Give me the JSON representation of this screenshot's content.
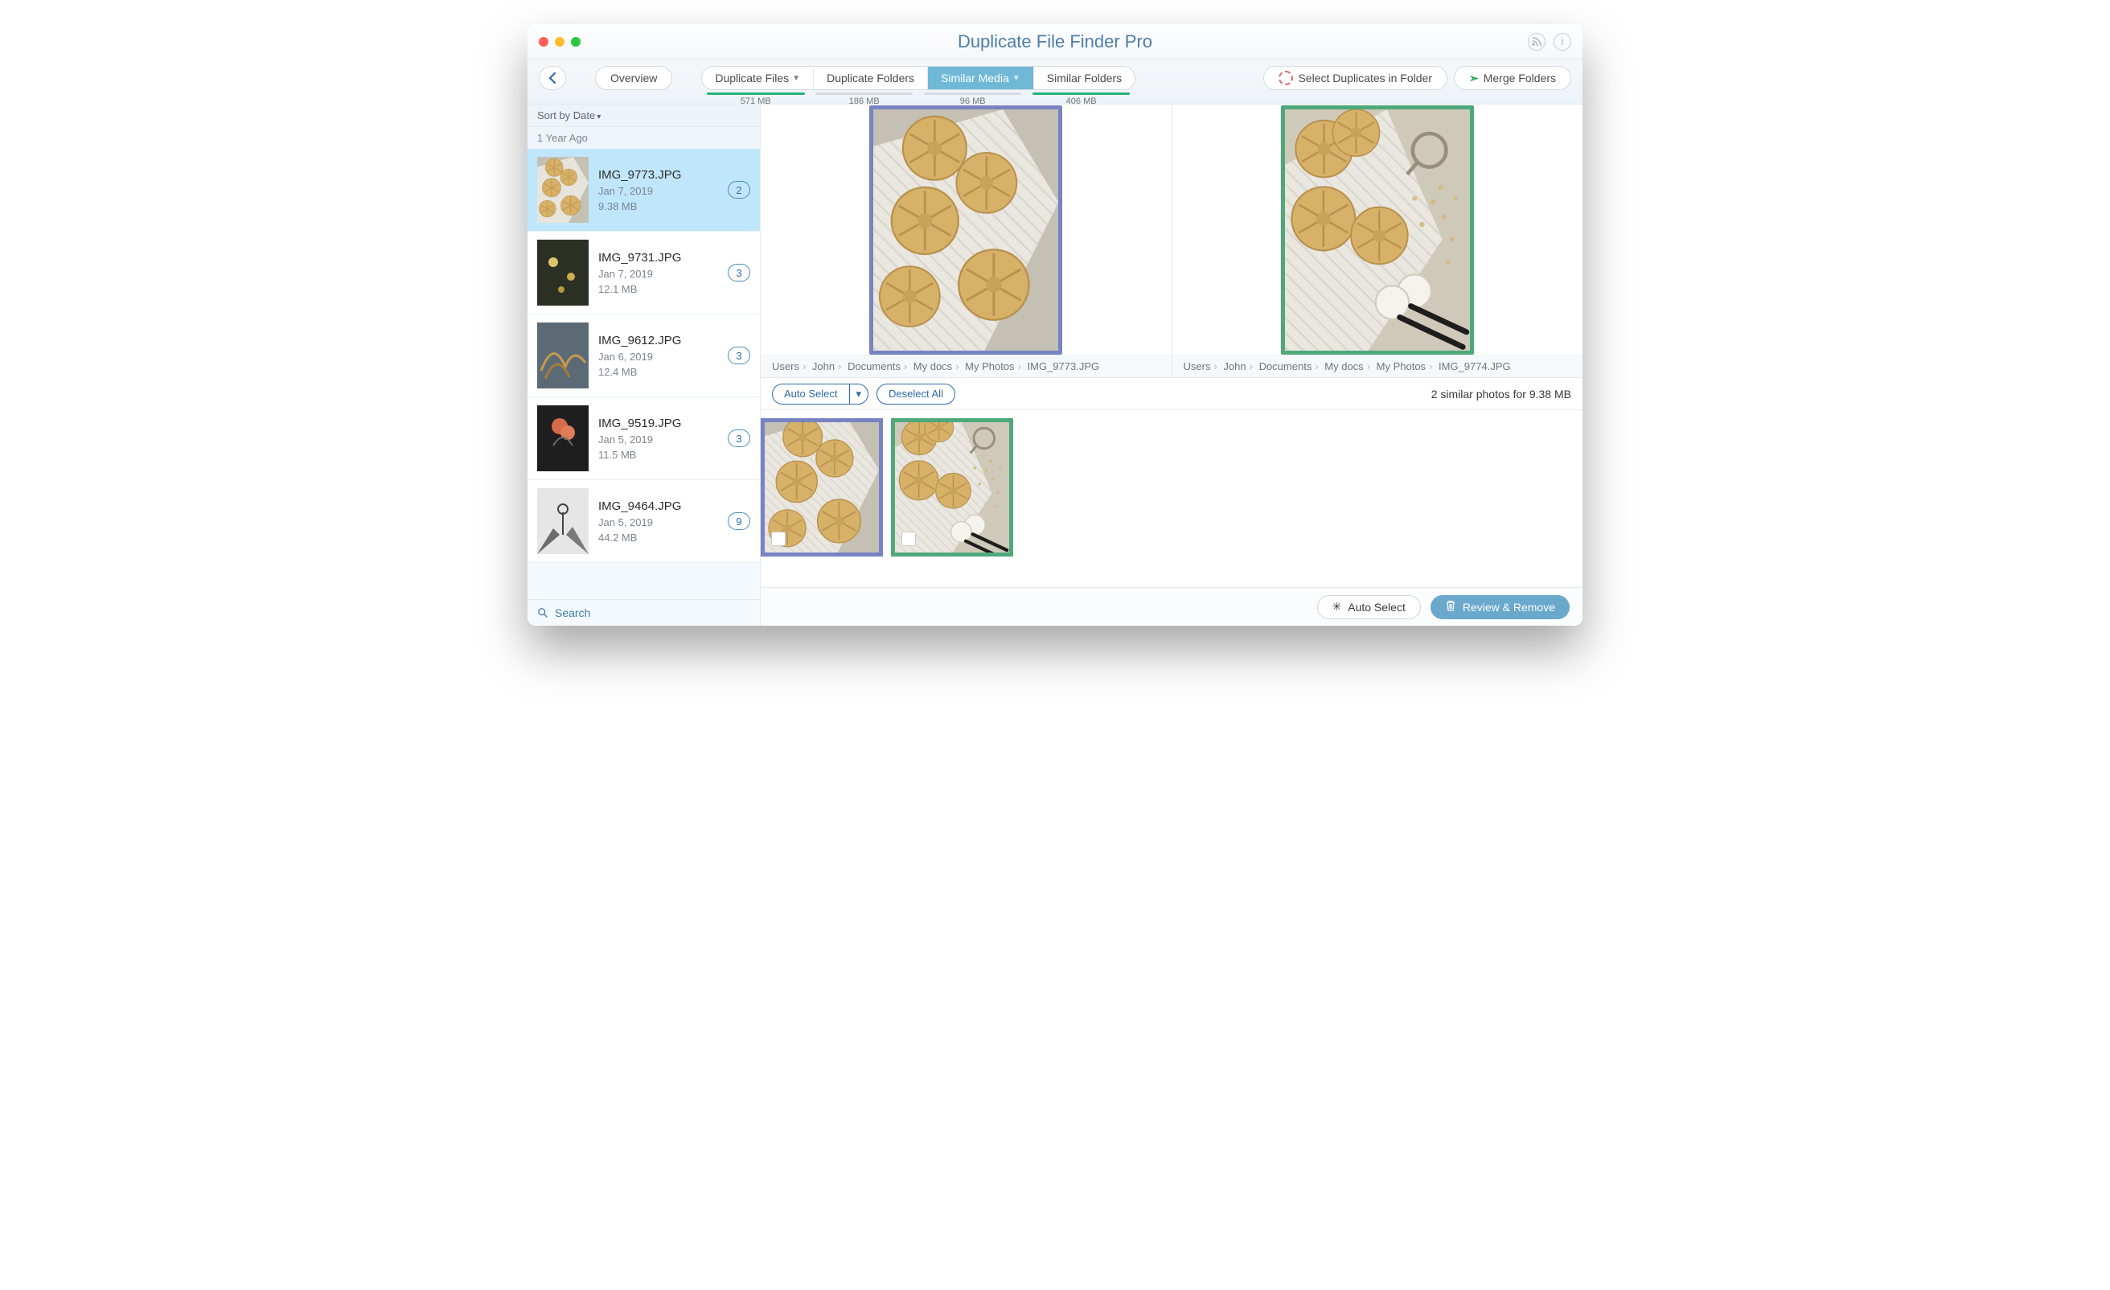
{
  "window": {
    "title": "Duplicate File Finder Pro"
  },
  "toolbar": {
    "overview": "Overview",
    "tabs": [
      {
        "label": "Duplicate Files",
        "size": "571 MB",
        "fill": 100,
        "color": "#26b37a",
        "caret": true
      },
      {
        "label": "Duplicate Folders",
        "size": "186 MB",
        "fill": 0,
        "color": "#26b37a"
      },
      {
        "label": "Similar Media",
        "size": "96 MB",
        "fill": 0,
        "color": "#26b37a",
        "active": true,
        "caret": true
      },
      {
        "label": "Similar Folders",
        "size": "406 MB",
        "fill": 100,
        "color": "#26b37a"
      }
    ],
    "select_dup": "Select Duplicates in Folder",
    "merge": "Merge Folders"
  },
  "sidebar": {
    "sort": "Sort by Date",
    "section": "1 Year Ago",
    "search_placeholder": "Search",
    "items": [
      {
        "name": "IMG_9773.JPG",
        "date": "Jan 7, 2019",
        "size": "9.38 MB",
        "count": "2",
        "selected": true
      },
      {
        "name": "IMG_9731.JPG",
        "date": "Jan 7, 2019",
        "size": "12.1 MB",
        "count": "3"
      },
      {
        "name": "IMG_9612.JPG",
        "date": "Jan 6, 2019",
        "size": "12.4 MB",
        "count": "3"
      },
      {
        "name": "IMG_9519.JPG",
        "date": "Jan 5, 2019",
        "size": "11.5 MB",
        "count": "3"
      },
      {
        "name": "IMG_9464.JPG",
        "date": "Jan 5, 2019",
        "size": "44.2 MB",
        "count": "9"
      }
    ]
  },
  "previews": [
    {
      "path": [
        "Users",
        "John",
        "Documents",
        "My docs",
        "My Photos",
        "IMG_9773.JPG"
      ],
      "border": "purple"
    },
    {
      "path": [
        "Users",
        "John",
        "Documents",
        "My docs",
        "My Photos",
        "IMG_9774.JPG"
      ],
      "border": "green"
    }
  ],
  "actions": {
    "auto_select": "Auto Select",
    "deselect_all": "Deselect All",
    "status": "2 similar photos for 9.38 MB"
  },
  "thumbs": [
    {
      "border": "purple"
    },
    {
      "border": "green"
    }
  ],
  "footer": {
    "auto_select": "Auto Select",
    "review_remove": "Review & Remove"
  }
}
